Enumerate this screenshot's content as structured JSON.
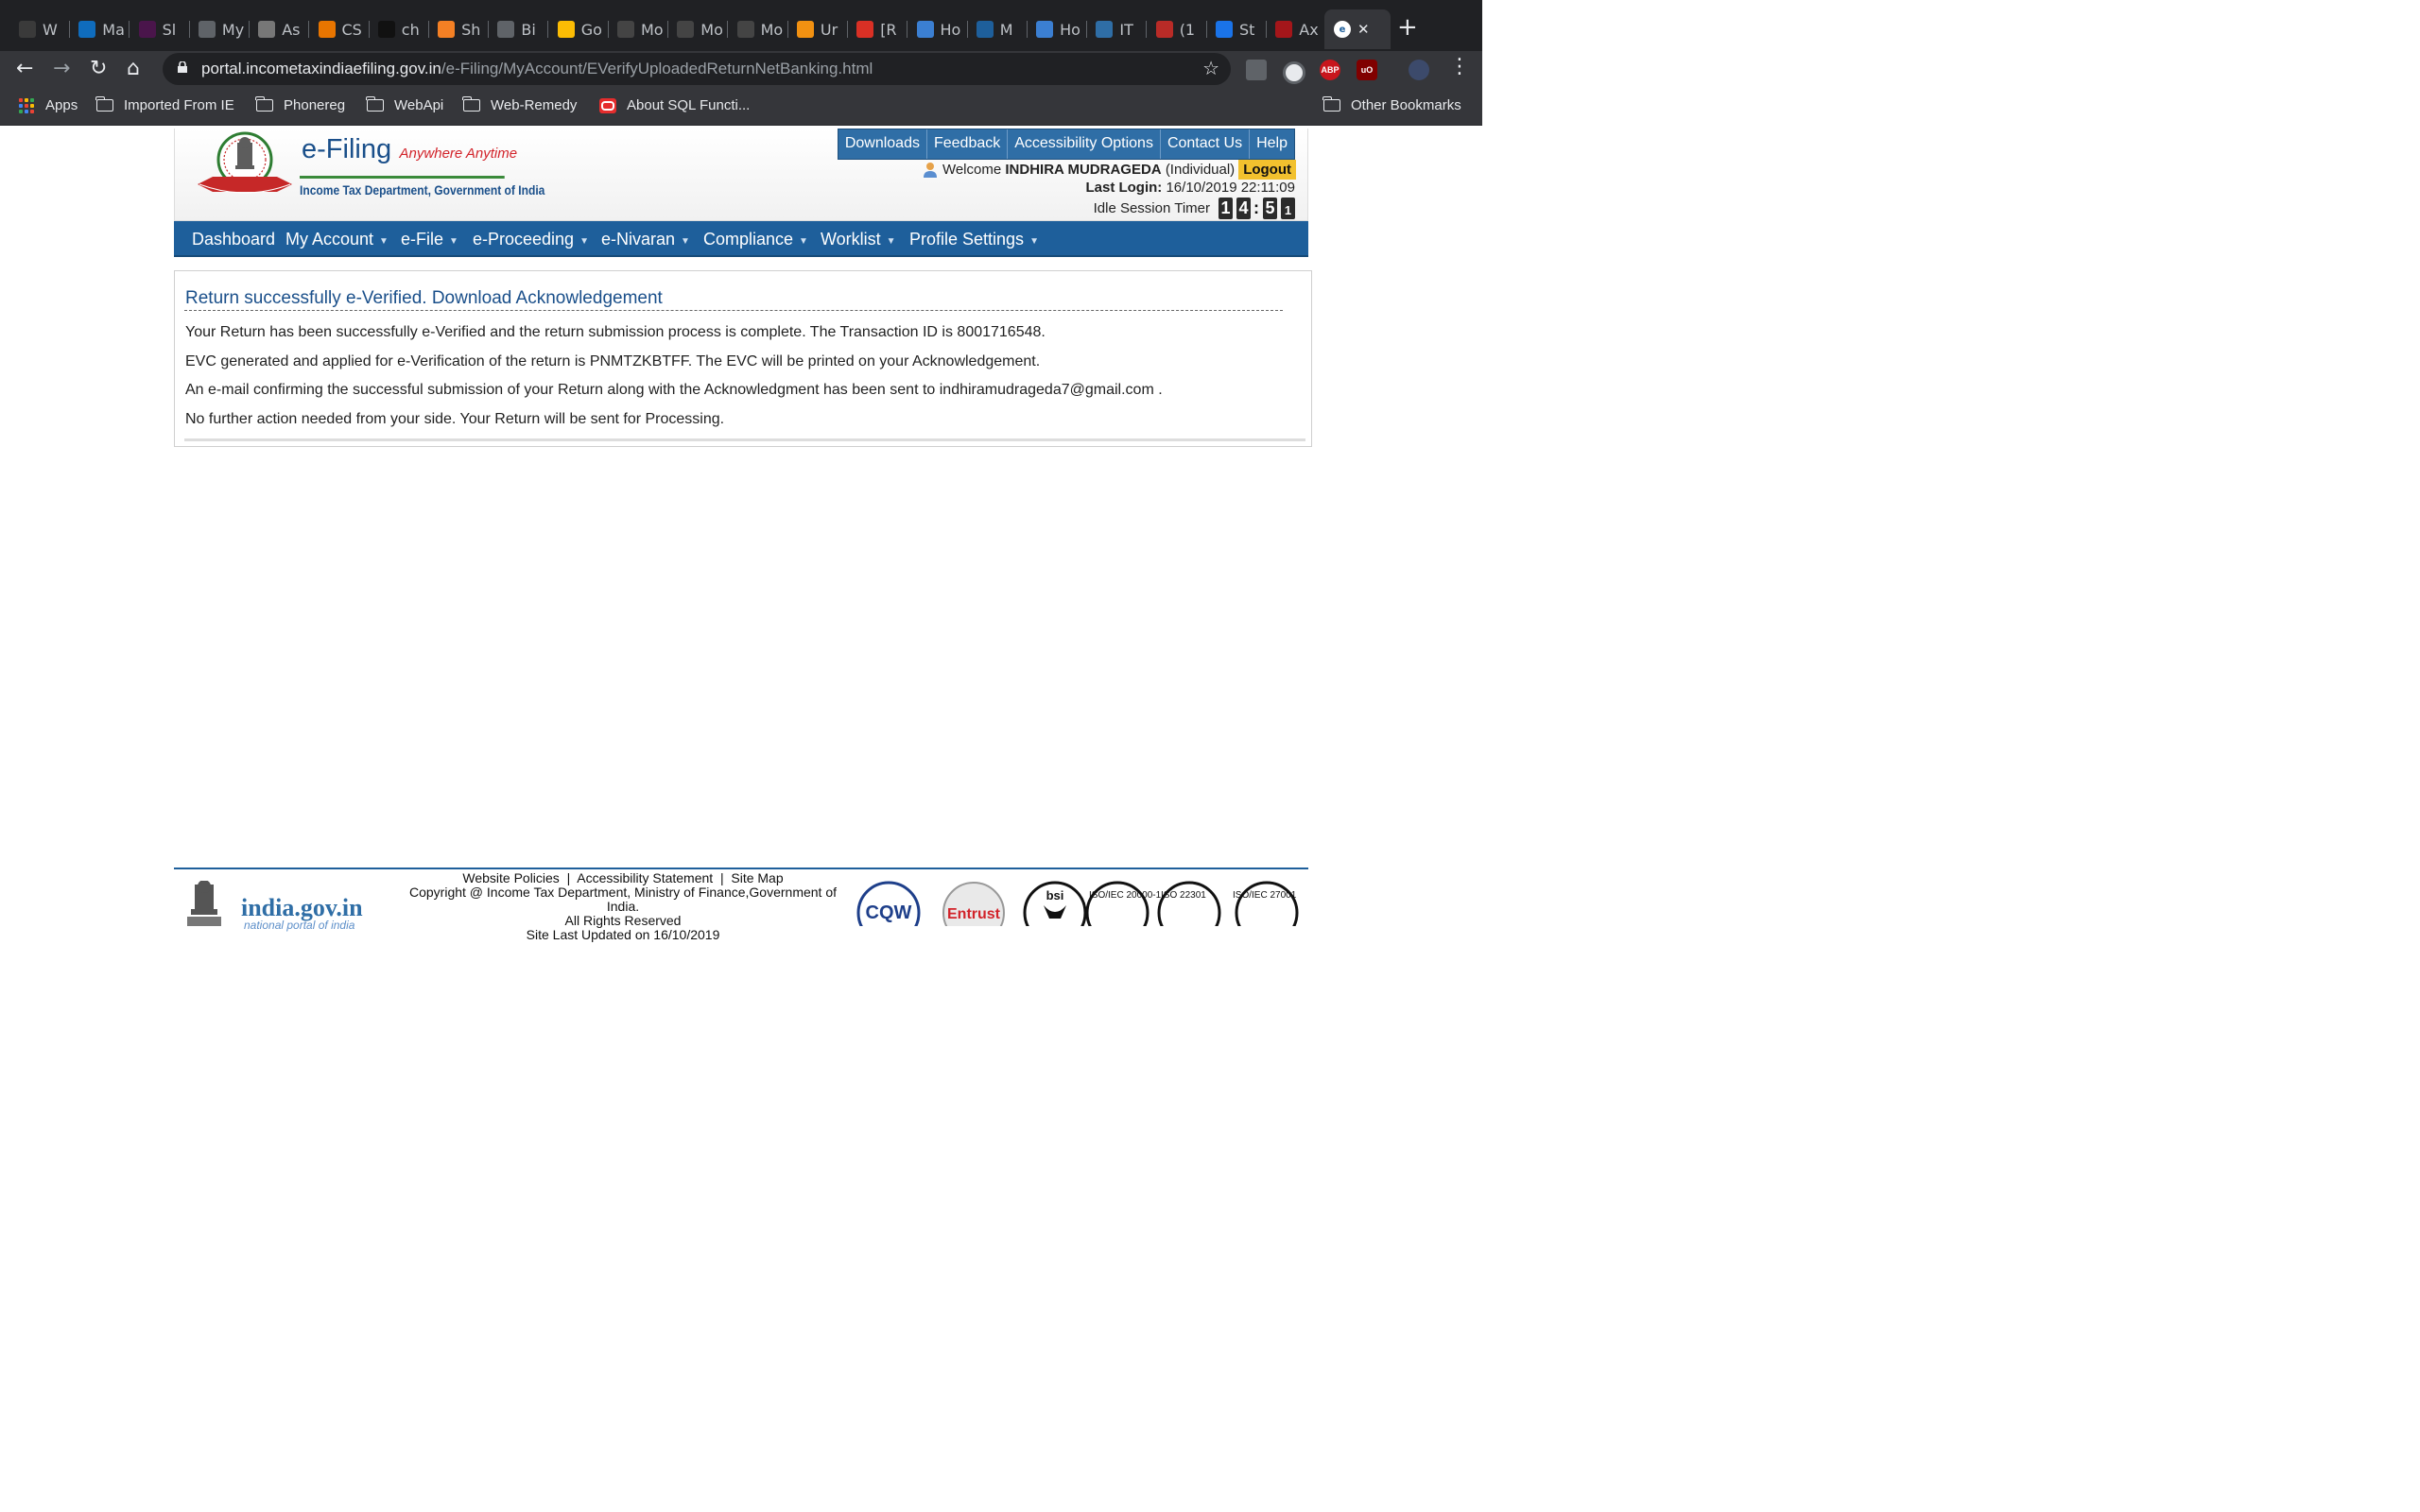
{
  "browser": {
    "tabs": [
      {
        "label": "W",
        "icon": "blackboard-icon"
      },
      {
        "label": "Ma",
        "icon": "outlook-icon"
      },
      {
        "label": "Sl",
        "icon": "slack-icon"
      },
      {
        "label": "My",
        "icon": "globe-icon"
      },
      {
        "label": "As",
        "icon": "library-icon"
      },
      {
        "label": "CS",
        "icon": "utd-icon"
      },
      {
        "label": "ch",
        "icon": "github-icon"
      },
      {
        "label": "Sh",
        "icon": "stackoverflow-icon"
      },
      {
        "label": "Bi",
        "icon": "globe-icon"
      },
      {
        "label": "Go",
        "icon": "keep-icon"
      },
      {
        "label": "Mo",
        "icon": "af-icon"
      },
      {
        "label": "Mo",
        "icon": "af-icon"
      },
      {
        "label": "Mo",
        "icon": "af-icon"
      },
      {
        "label": "Ur",
        "icon": "puzzle-icon"
      },
      {
        "label": "[R",
        "icon": "gmail-icon"
      },
      {
        "label": "Ho",
        "icon": "ie-globe-icon"
      },
      {
        "label": "M",
        "icon": "edge-icon"
      },
      {
        "label": "Ho",
        "icon": "ie-globe-icon"
      },
      {
        "label": "IT",
        "icon": "edit-icon"
      },
      {
        "label": "(1",
        "icon": "quora-icon"
      },
      {
        "label": "St",
        "icon": "fingerprint-icon"
      },
      {
        "label": "Ax",
        "icon": "triangle-icon"
      }
    ],
    "new_tab": "+",
    "close_tab": "✕",
    "url_host": "portal.incometaxindiaefiling.gov.in",
    "url_path": "/e-Filing/MyAccount/EVerifyUploadedReturnNetBanking.html",
    "extensions": [
      "cube-icon",
      "circle-icon",
      "ABP",
      "uO",
      "avatar-icon",
      "menu-icon"
    ],
    "bookmarks": [
      {
        "label": "Apps",
        "icon": "apps-grid-icon"
      },
      {
        "label": "Imported From IE",
        "icon": "folder-icon"
      },
      {
        "label": "Phonereg",
        "icon": "folder-icon"
      },
      {
        "label": "WebApi",
        "icon": "folder-icon"
      },
      {
        "label": "Web-Remedy",
        "icon": "folder-icon"
      },
      {
        "label": "About SQL Functi...",
        "icon": "oracle-icon"
      }
    ],
    "other_bookmarks": "Other Bookmarks"
  },
  "header": {
    "brand": "e-Filing",
    "tagline": "Anywhere Anytime",
    "department": "Income Tax Department, Government of India",
    "top_links": [
      "Downloads",
      "Feedback",
      "Accessibility Options",
      "Contact Us",
      "Help"
    ],
    "welcome_prefix": "Welcome",
    "user_name": "INDHIRA MUDRAGEDA",
    "user_type": "(Individual)",
    "logout": "Logout",
    "last_login_label": "Last Login:",
    "last_login_value": "16/10/2019 22:11:09",
    "idle_label": "Idle Session Timer",
    "idle_digits": [
      "1",
      "4",
      "5",
      "1"
    ]
  },
  "nav": [
    "Dashboard",
    "My Account",
    "e-File",
    "e-Proceeding",
    "e-Nivaran",
    "Compliance",
    "Worklist",
    "Profile Settings"
  ],
  "content": {
    "title": "Return successfully e-Verified. Download Acknowledgement",
    "lines": [
      "Your Return has been successfully e-Verified and the return submission process is complete. The Transaction ID is 8001716548.",
      "EVC generated and applied for e-Verification of the return is PNMTZKBTFF. The EVC will be printed on your Acknowledgement.",
      "An e-mail confirming the successful submission of your Return along with the Acknowledgment has been sent to indhiramudrageda7@gmail.com .",
      "No further action needed from your side. Your Return will be sent for Processing."
    ]
  },
  "footer": {
    "links": "Website Policies  |  Accessibility Statement  |  Site Map",
    "copyright": "Copyright @ Income Tax Department, Ministry of Finance,Government of India.",
    "rights": "All Rights Reserved",
    "updated": "Site Last Updated on 16/10/2019",
    "india_gov": "india.gov.in",
    "india_gov_sub": "national portal of india",
    "badges": [
      "CQW",
      "Entrust",
      "bsi",
      "ISO/IEC 20000-1",
      "ISO 22301",
      "ISO/IEC 27001"
    ]
  }
}
